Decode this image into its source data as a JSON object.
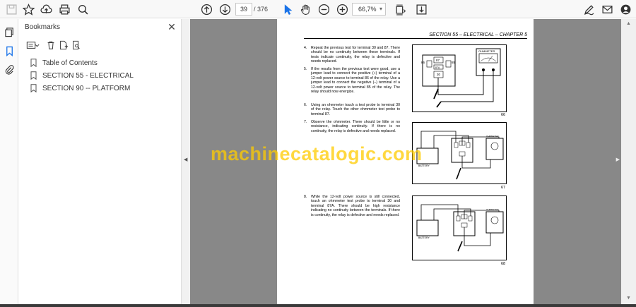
{
  "toolbar": {
    "current_page": "39",
    "total_pages": "/ 376",
    "zoom": "66,7%"
  },
  "bookmarks": {
    "title": "Bookmarks",
    "items": [
      {
        "label": "Table of Contents"
      },
      {
        "label": "SECTION 55 - ELECTRICAL"
      },
      {
        "label": "SECTION 90 -- PLATFORM"
      }
    ]
  },
  "document": {
    "section_header": "SECTION 55 – ELECTRICAL – CHAPTER 5",
    "steps": [
      {
        "num": "4.",
        "text": "Repeat the previous test for terminal 30 and 87. There should be no continuity between these terminals. If tests indicate continuity, the relay is defective and needs replaced."
      },
      {
        "num": "5.",
        "text": "If the results from the previous test were good, use a jumper lead to connect the positive (+) terminal of a 12-volt power source to terminal 86 of the relay. Use a jumper lead to connect the negative (–) terminal of a 12-volt power source to terminal 85 of the relay. The relay should now energize."
      },
      {
        "num": "6.",
        "text": "Using an ohmmeter touch a test probe to terminal 30 of the relay. Touch the other ohmmeter test probe to terminal 87."
      },
      {
        "num": "7.",
        "text": "Observe the ohmmeter. There should be little or no resistance, indicating continuity. If there is no continuity, the relay is defective and needs replaced."
      },
      {
        "num": "8.",
        "text": "While the 12-volt power source is still connected, touch an ohmmeter test probe to terminal 30 and terminal 87A. There should be high resistance indicating no continuity between the terminals. If there is continuity, the relay is defective and needs replaced."
      }
    ],
    "figures": [
      {
        "num": "66",
        "meter_label": "OHMMETER",
        "t86": "86",
        "t87": "87",
        "t87a": "87A",
        "t85": "85",
        "t30": "30"
      },
      {
        "num": "67",
        "battery_label": "BATTERY",
        "meter_label": "OHMMETER"
      },
      {
        "num": "68",
        "battery_label": "BATTERY",
        "meter_label": "OHMMETER"
      }
    ]
  },
  "watermark": "machinecatalogic.com"
}
